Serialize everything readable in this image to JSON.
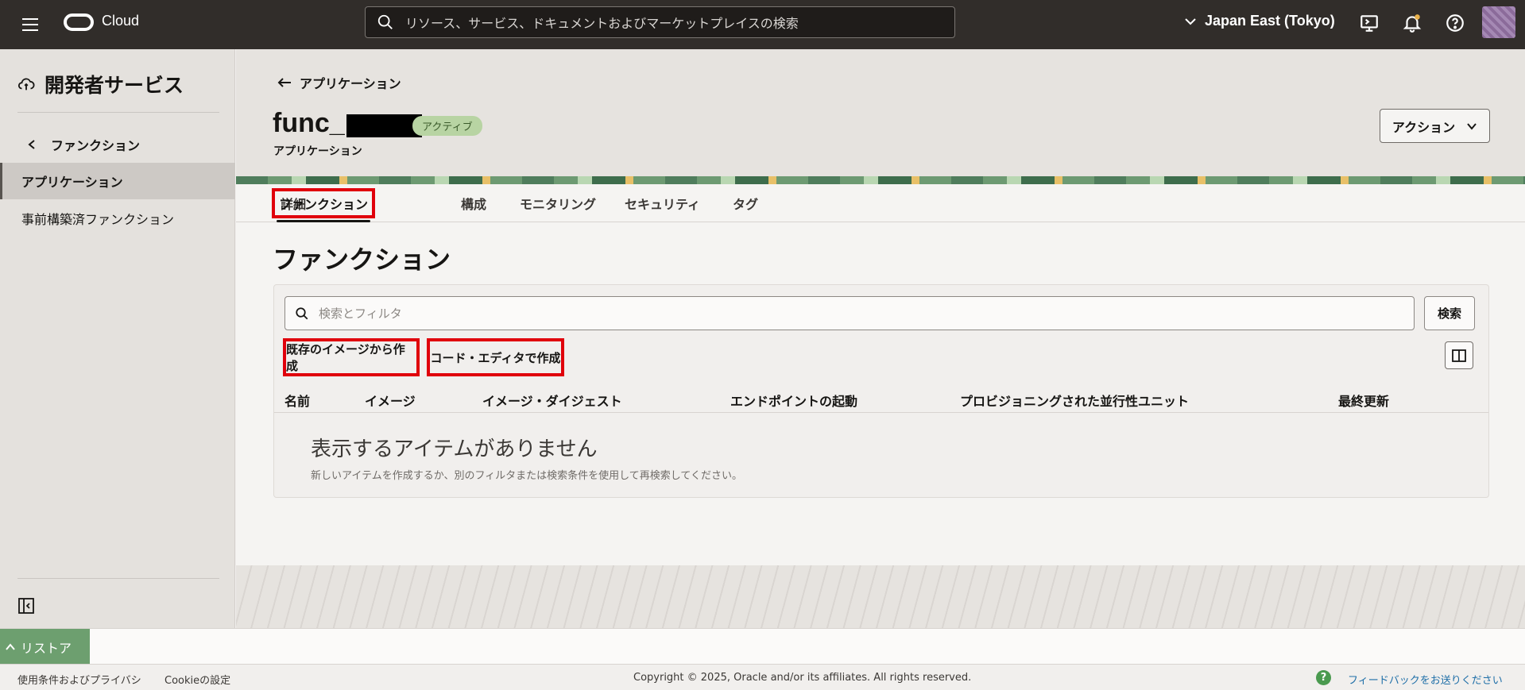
{
  "topbar": {
    "logo_text": "Cloud",
    "search_placeholder": "リソース、サービス、ドキュメントおよびマーケットプレイスの検索",
    "region": "Japan East (Tokyo)"
  },
  "sidebar": {
    "title": "開発者サービス",
    "back_label": "ファンクション",
    "items": [
      {
        "label": "アプリケーション",
        "active": true
      },
      {
        "label": "事前構築済ファンクション",
        "active": false
      }
    ]
  },
  "header": {
    "back_link": "アプリケーション",
    "title_prefix": "func_",
    "status_badge": "アクティブ",
    "subtitle": "アプリケーション",
    "actions_label": "アクション"
  },
  "tabs": [
    {
      "label": "詳細",
      "active": false
    },
    {
      "label": "ファンクション",
      "active": true
    },
    {
      "label": "構成",
      "active": false
    },
    {
      "label": "モニタリング",
      "active": false
    },
    {
      "label": "セキュリティ",
      "active": false
    },
    {
      "label": "タグ",
      "active": false
    }
  ],
  "content": {
    "heading": "ファンクション",
    "filter_placeholder": "検索とフィルタ",
    "search_button": "検索",
    "create_from_image": "既存のイメージから作成",
    "create_with_editor": "コード・エディタで作成",
    "columns": [
      "名前",
      "イメージ",
      "イメージ・ダイジェスト",
      "エンドポイントの起動",
      "プロビジョニングされた並行性ユニット",
      "最終更新"
    ],
    "empty_title": "表示するアイテムがありません",
    "empty_subtitle": "新しいアイテムを作成するか、別のフィルタまたは検索条件を使用して再検索してください。"
  },
  "restore": {
    "label": "リストア"
  },
  "footer": {
    "terms": "使用条件およびプライバシ",
    "cookies": "Cookieの設定",
    "copyright": "Copyright © 2025, Oracle and/or its affiliates. All rights reserved.",
    "feedback": "フィードバックをお送りください"
  },
  "colors": {
    "topbar": "#312d2a",
    "highlight": "#e0000b",
    "badge": "#b8d4a3",
    "restore": "#6d9f6f"
  }
}
